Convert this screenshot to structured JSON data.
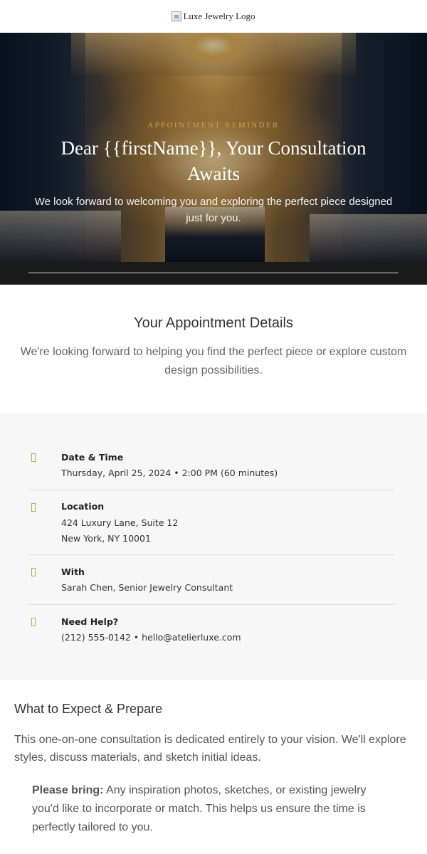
{
  "header": {
    "logo_alt": "Luxe Jewelry Logo"
  },
  "hero": {
    "eyebrow": "APPOINTMENT REMINDER",
    "title": "Dear {{firstName}}, Your Consultation Awaits",
    "subtitle": "We look forward to welcoming you and exploring the perfect piece designed just for you."
  },
  "details": {
    "title": "Your Appointment Details",
    "description": "We're looking forward to helping you find the perfect piece or explore custom design possibilities."
  },
  "info": {
    "datetime": {
      "label": "Date & Time",
      "value": "Thursday, April 25, 2024 • 2:00 PM (60 minutes)"
    },
    "location": {
      "label": "Location",
      "line1": "424 Luxury Lane, Suite 12",
      "line2": "New York, NY 10001"
    },
    "with": {
      "label": "With",
      "value": "Sarah Chen, Senior Jewelry Consultant"
    },
    "help": {
      "label": "Need Help?",
      "value": "(212) 555-0142 • hello@atelierluxe.com"
    }
  },
  "expect": {
    "title": "What to Expect & Prepare",
    "body": "This one-on-one consultation is dedicated entirely to your vision. We'll explore styles, discuss materials, and sketch initial ideas.",
    "note_label": "Please bring:",
    "note_text": " Any inspiration photos, sketches, or existing jewelry you'd like to incorporate or match. This helps us ensure the time is perfectly tailored to you."
  },
  "colors": {
    "accent_gold": "#c9a24a",
    "panel_bg": "#f7f7f7",
    "hero_dark": "#1a1a1a"
  }
}
